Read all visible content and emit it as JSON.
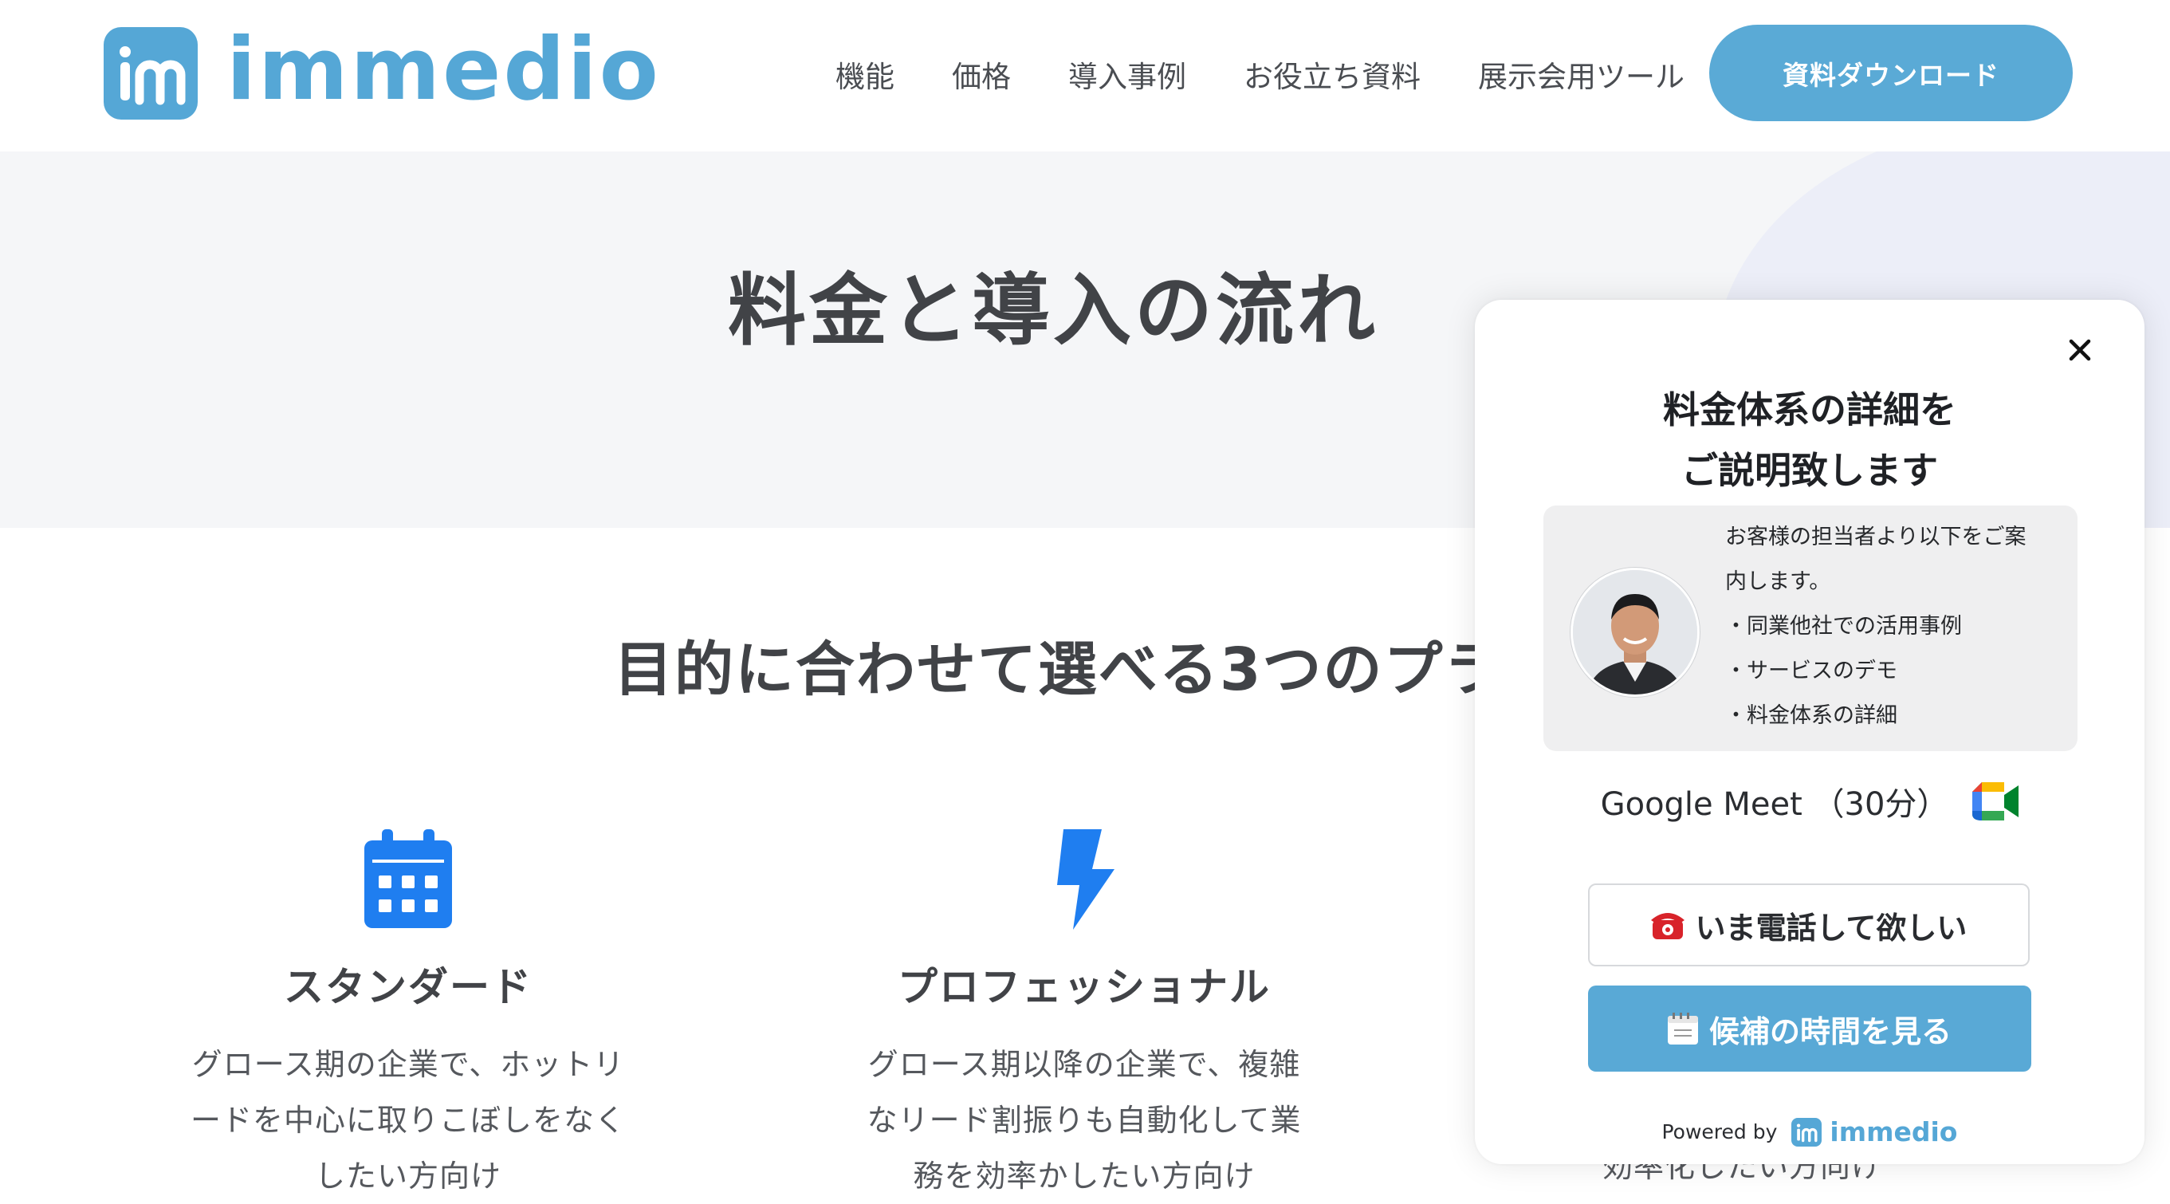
{
  "header": {
    "logo_text": "immedio",
    "nav": [
      "機能",
      "価格",
      "導入事例",
      "お役立ち資料",
      "展示会用ツール"
    ],
    "download_label": "資料ダウンロード"
  },
  "hero": {
    "title": "料金と導入の流れ"
  },
  "plans_section": {
    "title": "目的に合わせて選べる3つのプラ",
    "plans": [
      {
        "name": "スタンダード",
        "icon": "calendar-icon",
        "desc": [
          "グロース期の企業で、ホットリ",
          "ードを中心に取りこぼしをなく",
          "したい方向け"
        ]
      },
      {
        "name": "プロフェッショナル",
        "icon": "lightning-icon",
        "desc": [
          "グロース期以降の企業で、複雑",
          "なリード割振りも自動化して業",
          "務を効率かしたい方向け"
        ]
      }
    ],
    "plan3_partial_desc": "効率化したい方向け"
  },
  "popup": {
    "title_lines": [
      "料金体系の詳細を",
      "ご説明致します"
    ],
    "info_lines": [
      "お客様の担当者より以下をご案",
      "内します。",
      "・同業他社での活用事例",
      "・サービスのデモ",
      "・料金体系の詳細"
    ],
    "meeting_label": "Google Meet （30分）",
    "call_button": "いま電話して欲しい",
    "slots_button": "候補の時間を見る",
    "powered_by": "Powered by",
    "powered_brand": "immedio"
  },
  "colors": {
    "brand": "#55a7d6",
    "icon_blue": "#1f7ef0",
    "hero_bg": "#f5f6f8"
  }
}
